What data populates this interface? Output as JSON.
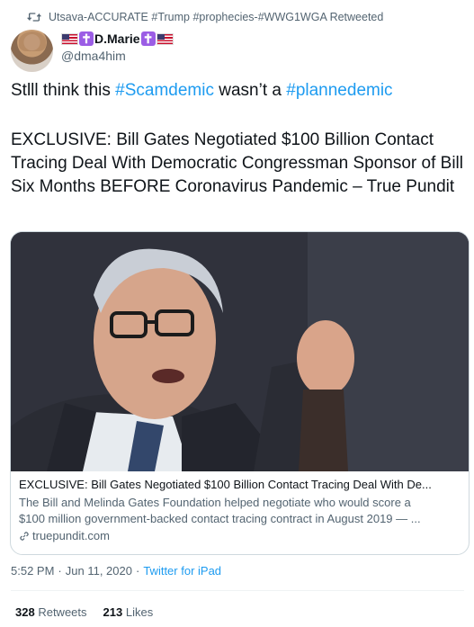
{
  "retweet": {
    "icon": "retweet-icon",
    "text": "Utsava-ACCURATE #Trump #prophecies-#WWG1WGA Retweeted"
  },
  "author": {
    "name": "D.Marie",
    "handle": "@dma4him"
  },
  "tweet": {
    "line1_prefix": "Stlll think this ",
    "hashtag1": "#Scamdemic",
    "line1_middle": " wasn’t a ",
    "hashtag2": "#plannedemic",
    "line2": "EXCLUSIVE: Bill Gates Negotiated $100 Billion Contact Tracing Deal With Democratic Congressman Sponsor of Bill Six Months BEFORE Coronavirus Pandemic – True Pundit"
  },
  "card": {
    "title": "EXCLUSIVE: Bill Gates Negotiated $100 Billion Contact Tracing Deal With De...",
    "desc_line1": "The Bill and Melinda Gates Foundation helped negotiate who would score a",
    "desc_line2": "$100 million government-backed contact tracing contract in August 2019 — ...",
    "domain": "truepundit.com"
  },
  "meta": {
    "time": "5:52 PM",
    "sep1": "·",
    "date": "Jun 11, 2020",
    "sep2": "·",
    "source": "Twitter for iPad"
  },
  "stats": {
    "retweets_count": "328",
    "retweets_label": "Retweets",
    "likes_count": "213",
    "likes_label": "Likes"
  },
  "colors": {
    "link": "#1d9bf0",
    "secondary": "#536471",
    "border": "#cfd9de"
  }
}
